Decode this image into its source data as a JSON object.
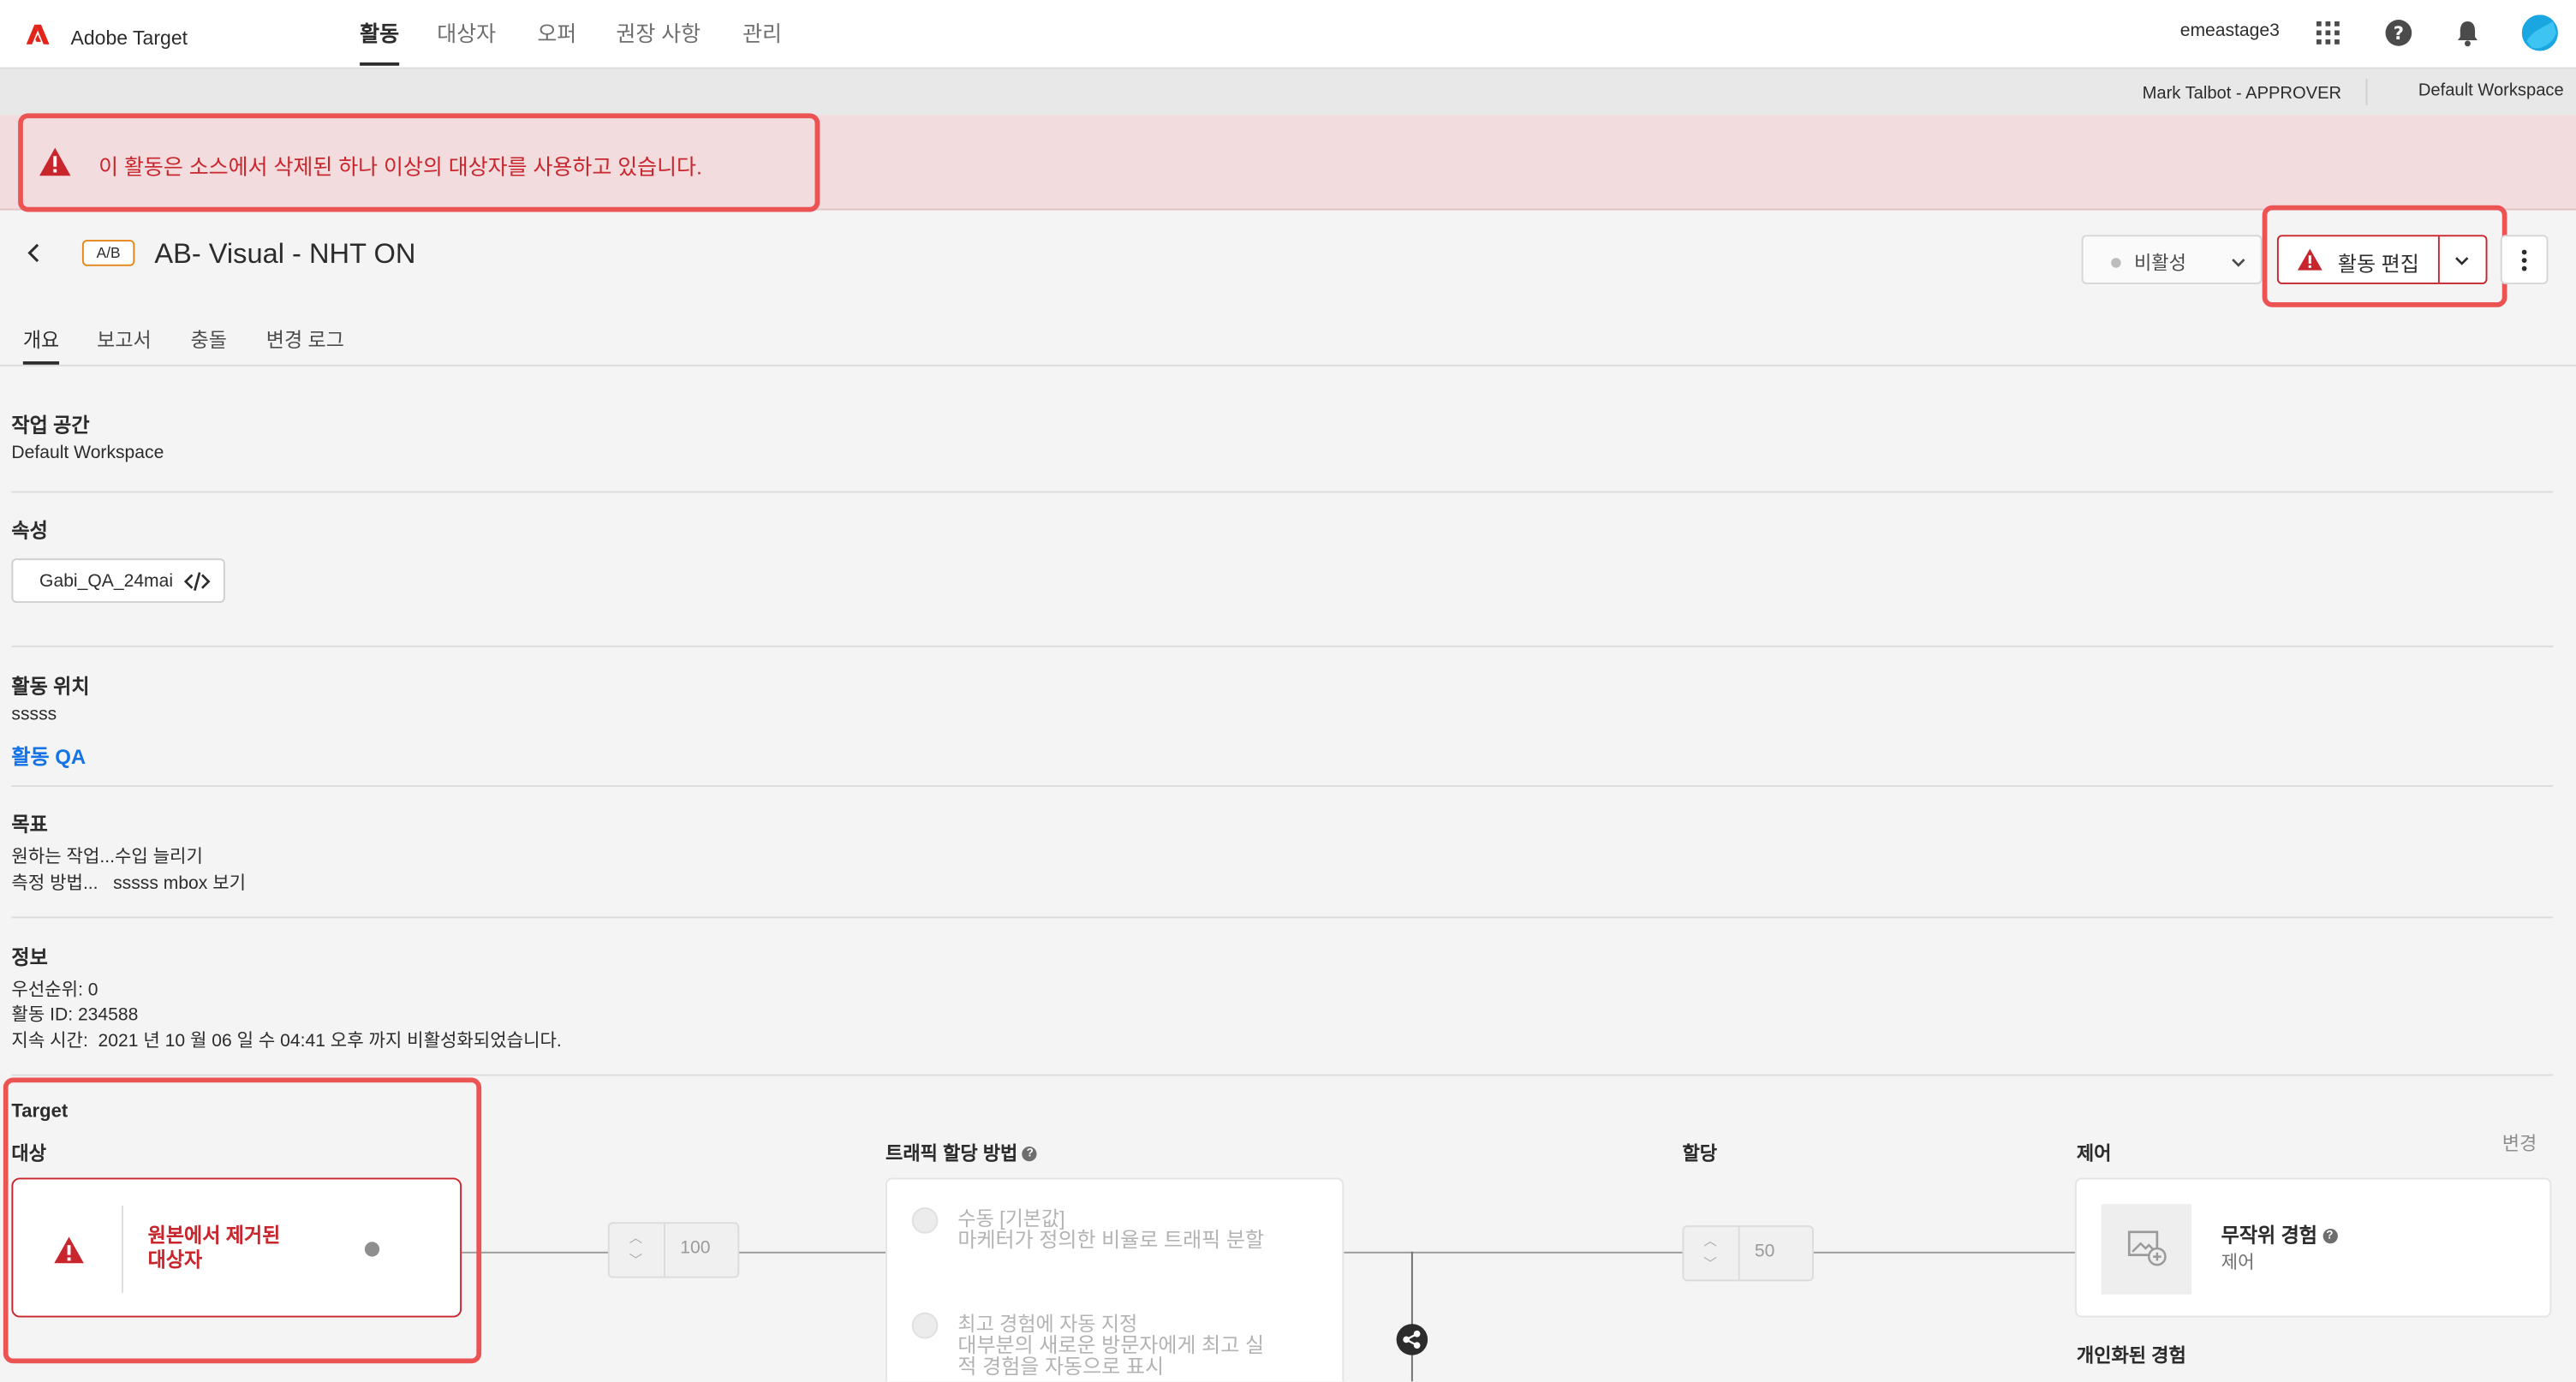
{
  "app": {
    "title": "Adobe Target"
  },
  "nav": {
    "tabs": [
      "활동",
      "대상자",
      "오퍼",
      "권장 사항",
      "관리"
    ],
    "active": "활동"
  },
  "header": {
    "org": "emeastage3"
  },
  "subbar": {
    "user": "Mark Talbot - APPROVER",
    "workspace": "Default Workspace"
  },
  "alert": {
    "message": "이 활동은 소스에서 삭제된 하나 이상의 대상자를 사용하고 있습니다."
  },
  "activity": {
    "type_badge": "A/B",
    "title": "AB- Visual - NHT ON",
    "status": "비활성",
    "edit_label": "활동 편집"
  },
  "tabs": [
    "개요",
    "보고서",
    "충돌",
    "변경 로그"
  ],
  "overview": {
    "workspace": {
      "heading": "작업 공간",
      "value": "Default Workspace"
    },
    "property": {
      "heading": "속성",
      "value": "Gabi_QA_24mai"
    },
    "location": {
      "heading": "활동 위치",
      "value": "sssss",
      "link": "활동 QA"
    },
    "goal": {
      "heading": "목표",
      "line1": "원하는 작업...수입 늘리기",
      "line2": "측정 방법...   sssss mbox 보기"
    },
    "info": {
      "heading": "정보",
      "priority": "우선순위: 0",
      "activity_id": "활동 ID: 234588",
      "duration": "지속 시간:  2021 년 10 월 06 일 수 04:41 오후 까지 비활성화되었습니다."
    }
  },
  "target": {
    "heading": "Target",
    "audience_label": "대상",
    "audience_removed": [
      "원본에서 제거된",
      "대상자"
    ],
    "audience_percent": "100",
    "traffic_heading": "트래픽 할당 방법",
    "options": [
      {
        "title": "수동 [기본값]",
        "desc": [
          "마케터가 정의한 비율로 트래픽 분할"
        ]
      },
      {
        "title": "최고 경험에 자동 지정",
        "desc": [
          "대부분의 새로운 방문자에게 최고 실",
          "적 경험을 자동으로 표시"
        ]
      }
    ],
    "allocation_heading": "할당",
    "allocation_value": "50",
    "control_heading": "제어",
    "change_link": "변경",
    "control_card": {
      "title": "무작위 경험",
      "subtitle": "제어"
    },
    "personalized_heading": "개인화된 경험"
  },
  "colors": {
    "accent_red": "#c9252d",
    "highlight": "#ec5454",
    "alert_bg": "#f2dcdd",
    "link_blue": "#1473e6",
    "avatar": "#1aa6e0"
  },
  "icons": [
    "adobe-logo-icon",
    "apps-grid-icon",
    "help-icon",
    "bell-icon",
    "avatar-icon",
    "warning-icon",
    "back-chevron-icon",
    "chevron-down-icon",
    "more-vertical-icon",
    "code-icon",
    "info-icon",
    "share-icon",
    "image-add-icon"
  ]
}
